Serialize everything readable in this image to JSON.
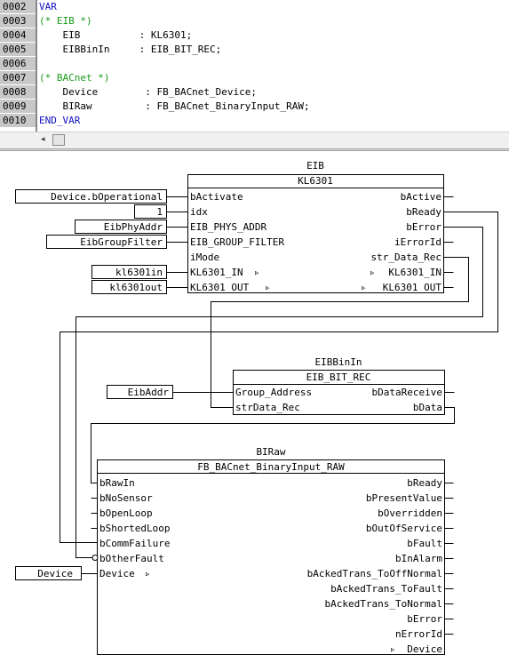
{
  "code": {
    "line_numbers": [
      "0002",
      "0003",
      "0004",
      "0005",
      "0006",
      "0007",
      "0008",
      "0009",
      "0010"
    ],
    "lines": {
      "l1": "VAR",
      "l2": "(* EIB *)",
      "l3": "    EIB          : KL6301;",
      "l4": "    EIBBinIn     : EIB_BIT_REC;",
      "l5": "",
      "l6": "(* BACnet *)",
      "l7": "    Device        : FB_BACnet_Device;",
      "l8": "    BIRaw         : FB_BACnet_BinaryInput_RAW;",
      "l9": "END_VAR"
    }
  },
  "scrollbar": {
    "left_arrow": "◂"
  },
  "fbd": {
    "eib": {
      "instance": "EIB",
      "type": "KL6301",
      "inputs": [
        "bActivate",
        "idx",
        "EIB_PHYS_ADDR",
        "EIB_GROUP_FILTER",
        "iMode",
        "KL6301_IN",
        "KL6301_OUT"
      ],
      "outputs": [
        "bActive",
        "bReady",
        "bError",
        "iErrorId",
        "str_Data_Rec",
        "KL6301_IN",
        "KL6301_OUT"
      ]
    },
    "eib_vars": {
      "v1": "Device.bOperational",
      "v2": "1",
      "v3": "EibPhyAddr",
      "v4": "EibGroupFilter",
      "v5": "kl6301in",
      "v6": "kl6301out"
    },
    "binin": {
      "instance": "EIBBinIn",
      "type": "EIB_BIT_REC",
      "inputs": [
        "Group_Address",
        "strData_Rec"
      ],
      "outputs": [
        "bDataReceive",
        "bData"
      ]
    },
    "binin_vars": {
      "v1": "EibAddr"
    },
    "biraw": {
      "instance": "BIRaw",
      "type": "FB_BACnet_BinaryInput_RAW",
      "inputs": [
        "bRawIn",
        "bNoSensor",
        "bOpenLoop",
        "bShortedLoop",
        "bCommFailure",
        "bOtherFault",
        "Device"
      ],
      "outputs": [
        "bReady",
        "bPresentValue",
        "bOverridden",
        "bOutOfService",
        "bFault",
        "bInAlarm",
        "bAckedTrans_ToOffNormal",
        "bAckedTrans_ToFault",
        "bAckedTrans_ToNormal",
        "bError",
        "nErrorId",
        "Device"
      ]
    },
    "biraw_vars": {
      "v1": "Device"
    },
    "inout_marker": "▹"
  }
}
